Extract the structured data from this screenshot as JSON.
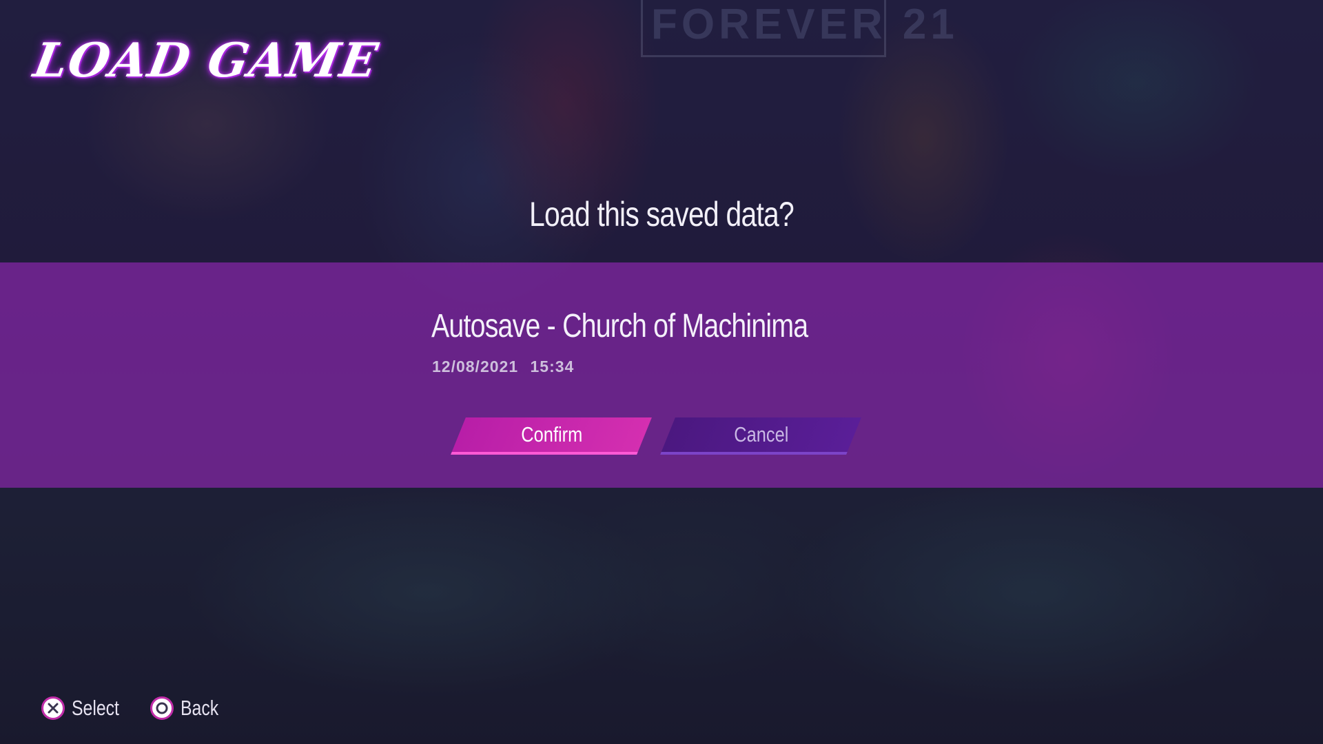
{
  "screen": {
    "title": "LOAD GAME",
    "background_sign_text": "FOREVER 21"
  },
  "dialog": {
    "prompt": "Load this saved data?",
    "save_name": "Autosave - Church of Machinima",
    "save_date": "12/08/2021",
    "save_time": "15:34",
    "confirm_label": "Confirm",
    "cancel_label": "Cancel"
  },
  "hints": {
    "select": {
      "icon": "cross-button-icon",
      "label": "Select"
    },
    "back": {
      "icon": "circle-button-icon",
      "label": "Back"
    }
  },
  "colors": {
    "band": "#9628b9",
    "confirm": "#d42fb0",
    "cancel": "#5a1e98",
    "title_glow": "#d03cff"
  }
}
